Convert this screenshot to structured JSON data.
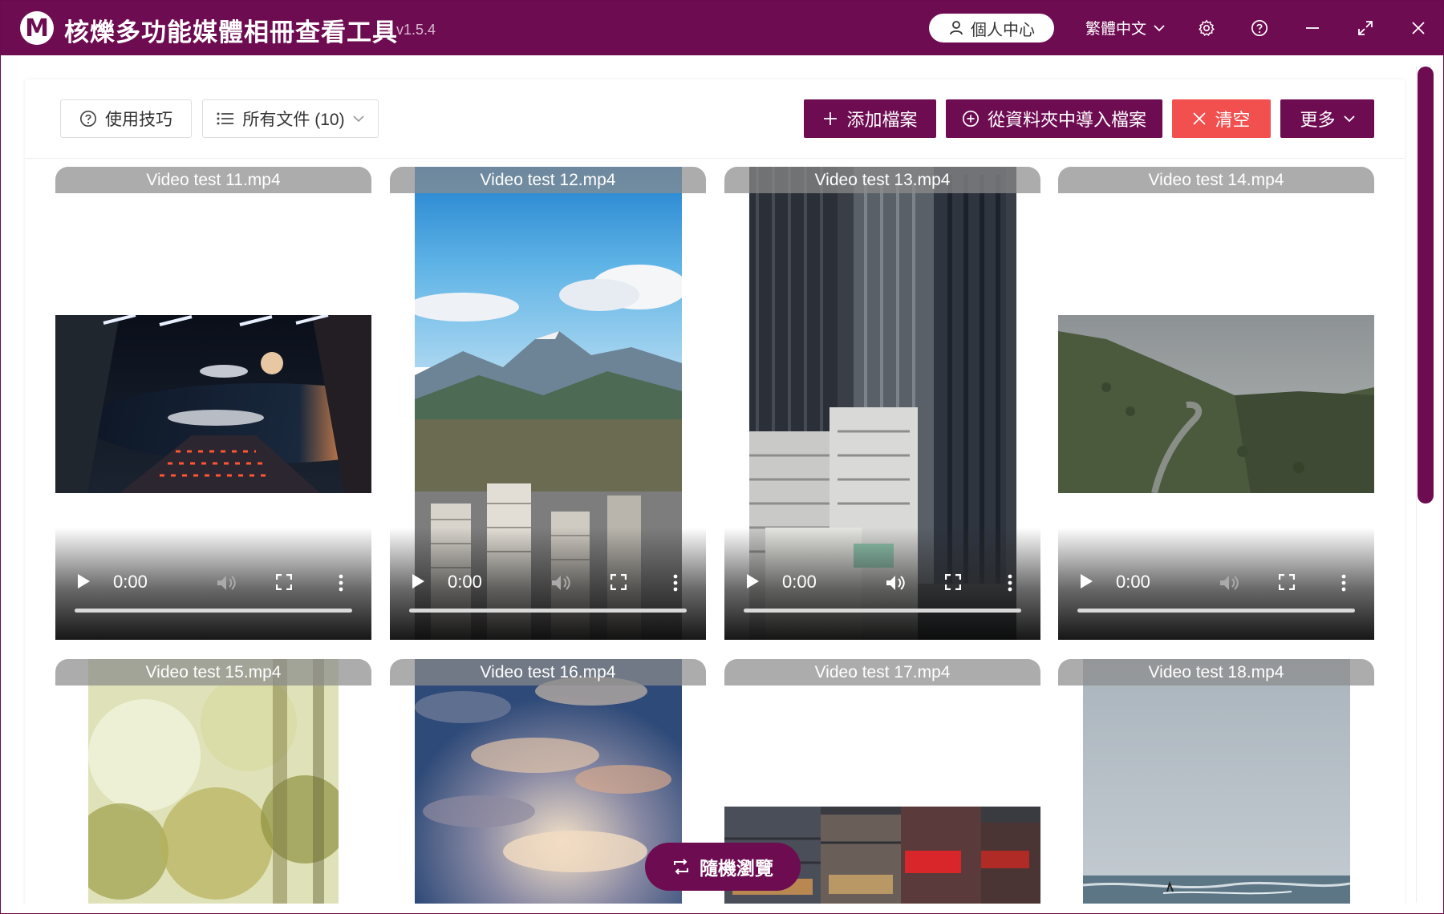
{
  "app": {
    "logo_letter": "M",
    "title": "核爍多功能媒體相冊查看工具",
    "version": "- v1.5.4"
  },
  "titlebar": {
    "profile_label": "個人中心",
    "language": "繁體中文"
  },
  "toolbar": {
    "tips_label": "使用技巧",
    "filter_label": "所有文件 (10)",
    "add_label": "添加檔案",
    "import_label": "從資料夾中導入檔案",
    "clear_label": "清空",
    "more_label": "更多"
  },
  "videos": [
    {
      "name": "Video test 11.mp4",
      "time": "0:00"
    },
    {
      "name": "Video test 12.mp4",
      "time": "0:00"
    },
    {
      "name": "Video test 13.mp4",
      "time": "0:00"
    },
    {
      "name": "Video test 14.mp4",
      "time": "0:00"
    },
    {
      "name": "Video test 15.mp4"
    },
    {
      "name": "Video test 16.mp4"
    },
    {
      "name": "Video test 17.mp4"
    },
    {
      "name": "Video test 18.mp4"
    }
  ],
  "random_browse_label": "隨機瀏覽",
  "colors": {
    "accent": "#6e0c52",
    "danger": "#f24f4f"
  }
}
